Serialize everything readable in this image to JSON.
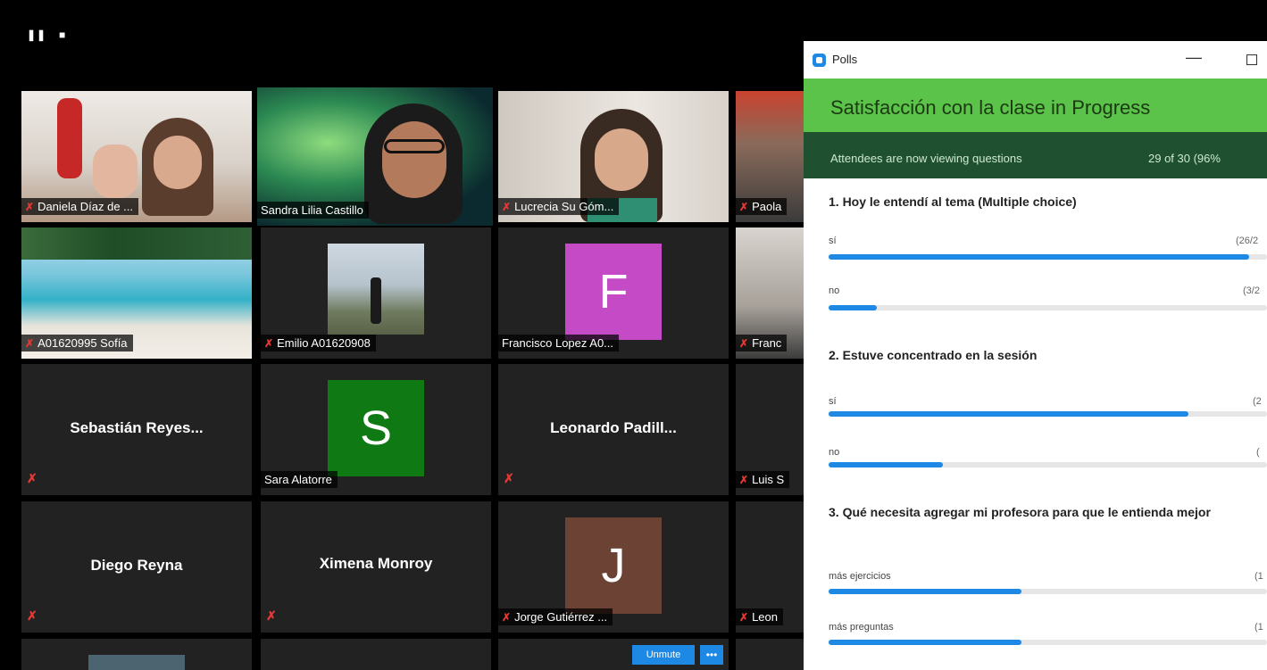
{
  "window_controls": {
    "pause": "❚❚",
    "stop": "■"
  },
  "participants": [
    {
      "name": "Daniela Díaz de ...",
      "type": "video",
      "muted": true
    },
    {
      "name": "Sandra Lilia Castillo",
      "type": "video",
      "muted": false,
      "active": true
    },
    {
      "name": "Lucrecia Su Góm...",
      "type": "video",
      "muted": true
    },
    {
      "name": "Paola",
      "type": "video",
      "muted": true
    },
    {
      "name": "A01620995 Sofía",
      "type": "video",
      "muted": true
    },
    {
      "name": "Emilio A01620908",
      "type": "photo",
      "muted": true
    },
    {
      "name": "Francisco Lopez A0...",
      "type": "avatar",
      "initial": "F",
      "color": "#c54bc6",
      "muted": false
    },
    {
      "name": "Franc",
      "type": "video",
      "muted": true
    },
    {
      "name": "Sebastián Reyes...",
      "type": "name",
      "muted": true
    },
    {
      "name": "Sara Alatorre",
      "type": "avatar",
      "initial": "S",
      "color": "#0f7a14",
      "muted": false
    },
    {
      "name": "Leonardo Padill...",
      "type": "name",
      "muted": true
    },
    {
      "name": "Luis S",
      "type": "name",
      "muted": true
    },
    {
      "name": "Diego Reyna",
      "type": "name",
      "muted": true
    },
    {
      "name": "Ximena Monroy",
      "type": "name",
      "muted": true
    },
    {
      "name": "Jorge Gutiérrez ...",
      "type": "avatar",
      "initial": "J",
      "color": "#6b4234",
      "muted": true
    },
    {
      "name": "Leon",
      "type": "name",
      "muted": true
    }
  ],
  "controls": {
    "unmute_label": "Unmute",
    "more_label": "•••"
  },
  "polls": {
    "window_title": "Polls",
    "poll_title": "Satisfacción con la clase  in Progress",
    "status": "Attendees are now viewing questions",
    "count": "29 of 30 (96%",
    "questions": [
      {
        "title": "1. Hoy le entendí al tema (Multiple choice)",
        "options": [
          {
            "label": "sí",
            "count": "(26/2",
            "fraction": 0.96
          },
          {
            "label": "no",
            "count": "(3/2",
            "fraction": 0.11
          }
        ]
      },
      {
        "title": "2. Estuve concentrado en la sesión",
        "options": [
          {
            "label": "sí",
            "count": "(2",
            "fraction": 0.82
          },
          {
            "label": "no",
            "count": "(",
            "fraction": 0.26
          }
        ]
      },
      {
        "title": "3. Qué necesita agregar mi profesora para que le entienda mejor",
        "options": [
          {
            "label": "más ejercicios",
            "count": "(1",
            "fraction": 0.44
          },
          {
            "label": "más preguntas",
            "count": "(1",
            "fraction": 0.44
          }
        ]
      }
    ]
  }
}
